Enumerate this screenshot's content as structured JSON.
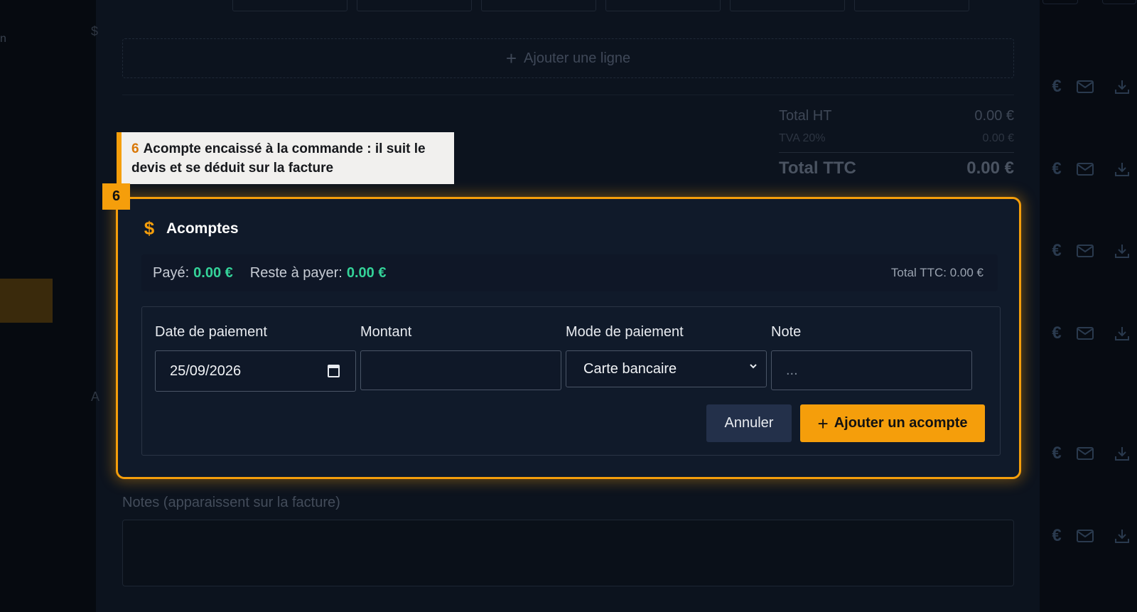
{
  "background": {
    "left_rail_text": "n",
    "left_rail_letter_top": "$",
    "left_rail_letter_bottom": "A",
    "add_line_label": "Ajouter une ligne",
    "totals": {
      "ht_label": "Total HT",
      "ht_value": "0.00 €",
      "tva_label": "TVA 20%",
      "tva_value": "0.00 €",
      "ttc_label": "Total TTC",
      "ttc_value": "0.00 €"
    },
    "notes_label": "Notes (apparaissent sur la facture)",
    "row_icons": [
      "euro-icon",
      "mail-icon",
      "download-icon"
    ]
  },
  "tooltip": {
    "step": "6",
    "text": "Acompte encaissé à la commande : il suit le devis et se déduit sur la facture"
  },
  "step_badge": "6",
  "acomptes": {
    "icon": "dollar-icon",
    "title": "Acomptes",
    "summary": {
      "paid_label": "Payé:",
      "paid_value": "0.00 €",
      "remaining_label": "Reste à payer:",
      "remaining_value": "0.00 €",
      "total_ttc": "Total TTC: 0.00 €"
    },
    "form": {
      "date_label": "Date de paiement",
      "date_value": "25/09/2026",
      "amount_label": "Montant",
      "amount_value": "",
      "mode_label": "Mode de paiement",
      "mode_value": "Carte bancaire",
      "note_label": "Note",
      "note_placeholder": "..."
    },
    "cancel_label": "Annuler",
    "add_label": "Ajouter un acompte"
  },
  "colors": {
    "accent": "#f59e0b",
    "positive": "#34d399",
    "panel_bg": "#101a2a"
  }
}
